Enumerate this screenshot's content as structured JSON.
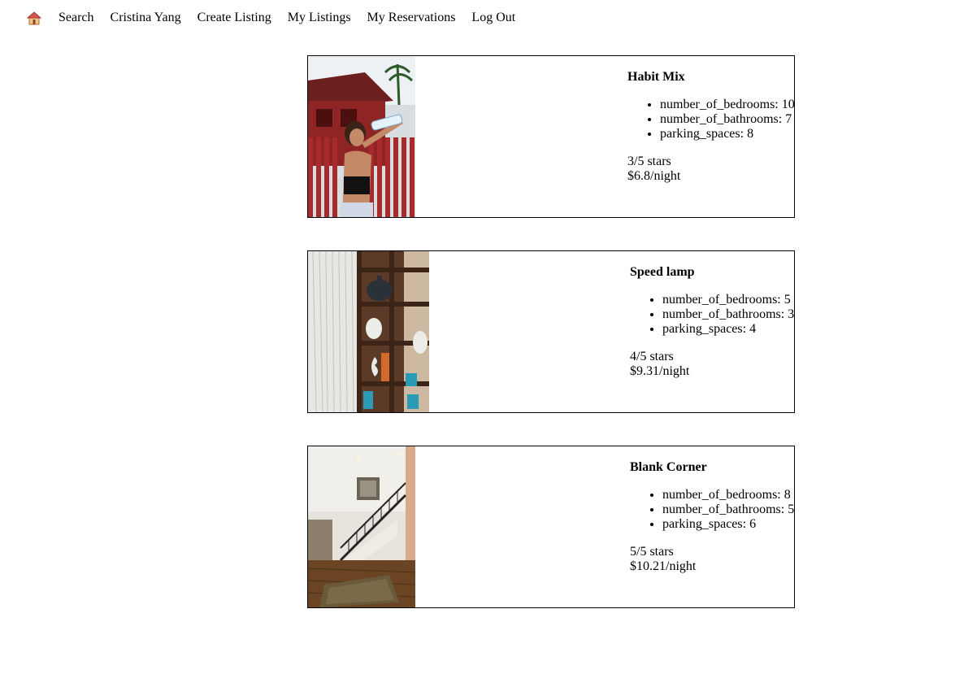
{
  "nav": {
    "home_icon": "home-icon",
    "items": [
      {
        "label": "Search"
      },
      {
        "label": "Cristina Yang"
      },
      {
        "label": "Create Listing"
      },
      {
        "label": "My Listings"
      },
      {
        "label": "My Reservations"
      },
      {
        "label": "Log Out"
      }
    ]
  },
  "listings": [
    {
      "title": "Habit Mix",
      "features": [
        "number_of_bedrooms: 10",
        "number_of_bathrooms: 7",
        "parking_spaces: 8"
      ],
      "rating": "3/5 stars",
      "price": "$6.8/night"
    },
    {
      "title": "Speed lamp",
      "features": [
        "number_of_bedrooms: 5",
        "number_of_bathrooms: 3",
        "parking_spaces: 4"
      ],
      "rating": "4/5 stars",
      "price": "$9.31/night"
    },
    {
      "title": "Blank Corner",
      "features": [
        "number_of_bedrooms: 8",
        "number_of_bathrooms: 5",
        "parking_spaces: 6"
      ],
      "rating": "5/5 stars",
      "price": "$10.21/night"
    }
  ]
}
